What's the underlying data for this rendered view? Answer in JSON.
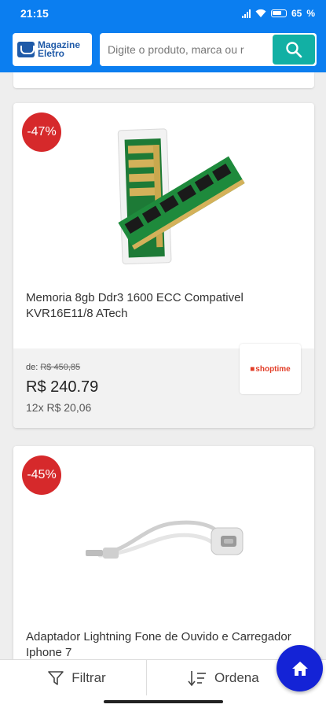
{
  "status": {
    "time": "21:15",
    "battery": "65"
  },
  "header": {
    "logo_line1": "Magazine",
    "logo_line2": "Eletro",
    "search_placeholder": "Digite o produto, marca ou r"
  },
  "products": [
    {
      "discount": "-47%",
      "title": "Memoria 8gb Ddr3 1600 ECC Compativel KVR16E11/8 ATech",
      "old_price_prefix": "de:",
      "old_price": "R$ 450,85",
      "price": "R$ 240.79",
      "installments": "12x R$ 20,06",
      "store": "shoptime"
    },
    {
      "discount": "-45%",
      "title": "Adaptador Lightning Fone de Ouvido e Carregador Iphone 7"
    }
  ],
  "bottom_bar": {
    "filter_label": "Filtrar",
    "sort_label": "Ordena"
  },
  "colors": {
    "header": "#0b7ef0",
    "search_button": "#12b0a4",
    "badge": "#d6292b",
    "fab": "#1423d6"
  }
}
